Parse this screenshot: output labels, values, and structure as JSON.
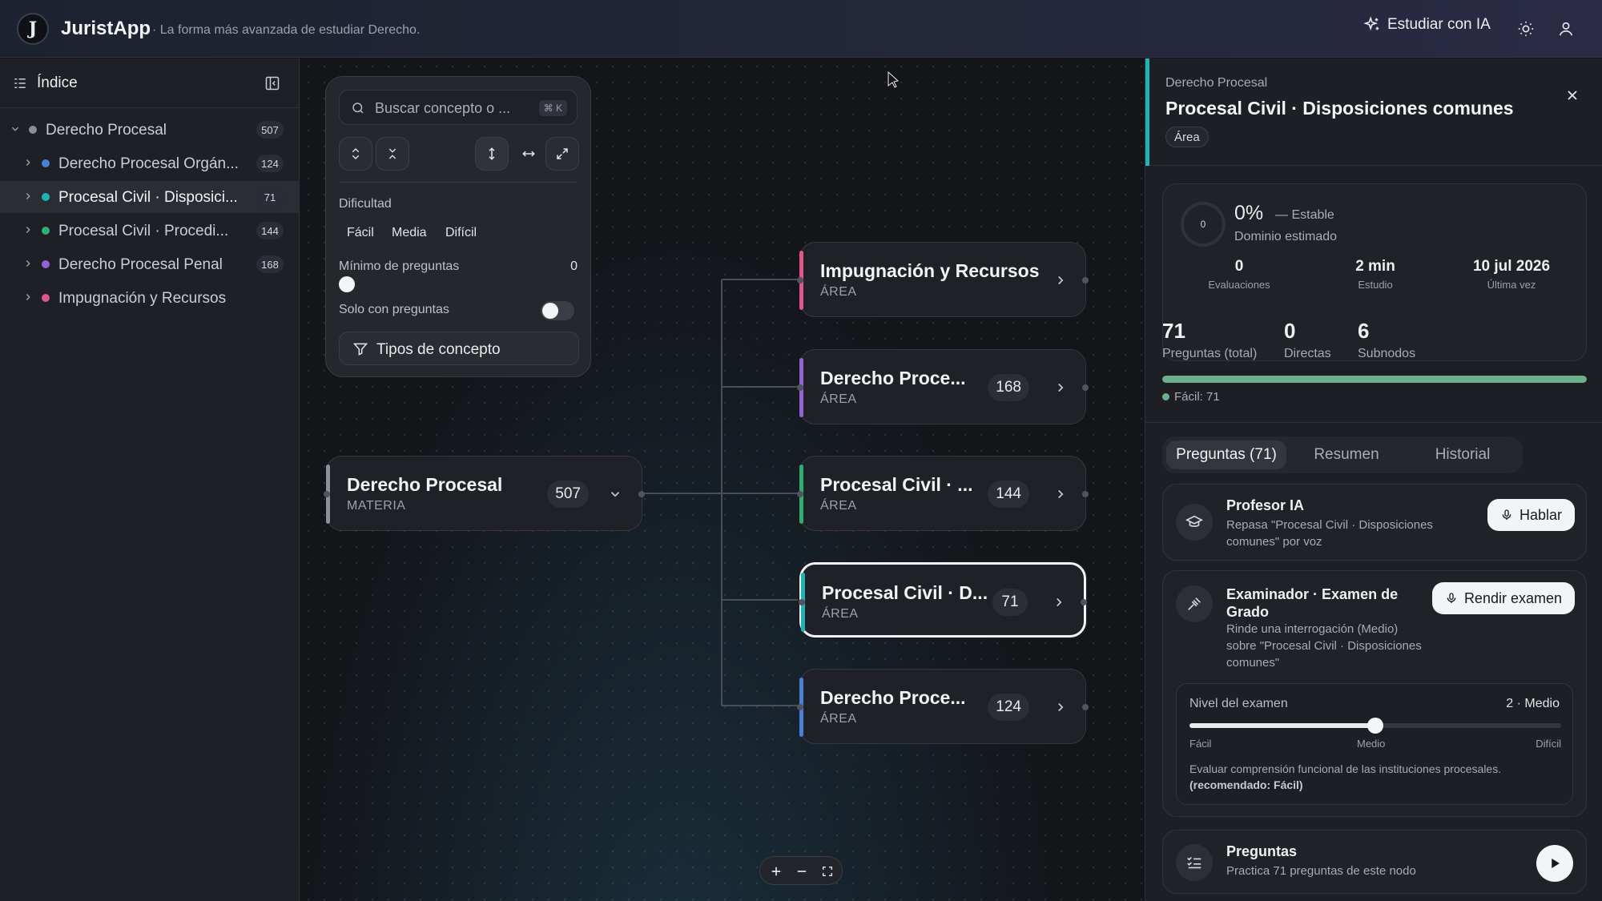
{
  "header": {
    "app_name": "JuristApp",
    "logo_letter": "J",
    "tagline": "· La forma más avanzada de estudiar Derecho.",
    "study_ai_label": "Estudiar con IA",
    "icons": [
      "sparkles-icon",
      "sun-icon",
      "user-icon"
    ]
  },
  "sidebar": {
    "title": "Índice",
    "items": [
      {
        "label": "Derecho Procesal",
        "count": "507",
        "color": "#8b8f98",
        "expanded": true,
        "level": 0
      },
      {
        "label": "Derecho Procesal Orgán...",
        "count": "124",
        "color": "#4a7fd6",
        "level": 1
      },
      {
        "label": "Procesal Civil · Disposici...",
        "count": "71",
        "color": "#1fb3b3",
        "level": 1,
        "active": true
      },
      {
        "label": "Procesal Civil · Procedi...",
        "count": "144",
        "color": "#2fae74",
        "level": 1
      },
      {
        "label": "Derecho Procesal Penal",
        "count": "168",
        "color": "#9363d6",
        "level": 1
      },
      {
        "label": "Impugnación y Recursos",
        "count": "",
        "color": "#e0568a",
        "level": 1
      }
    ]
  },
  "filters": {
    "search_placeholder": "Buscar concepto o ...",
    "shortcut": "⌘ K",
    "difficulty_label": "Dificultad",
    "difficulty_options": [
      "Fácil",
      "Media",
      "Difícil"
    ],
    "min_questions_label": "Mínimo de preguntas",
    "min_questions_value": "0",
    "only_with_questions_label": "Solo con preguntas",
    "concept_types_label": "Tipos de concepto"
  },
  "graph": {
    "root": {
      "title": "Derecho Procesal",
      "subtitle": "MATERIA",
      "count": "507"
    },
    "children": [
      {
        "title": "Impugnación y Recursos",
        "subtitle": "ÁREA",
        "count": "",
        "color": "#e0568a"
      },
      {
        "title": "Derecho Proce...",
        "subtitle": "ÁREA",
        "count": "168",
        "color": "#9363d6"
      },
      {
        "title": "Procesal Civil · ...",
        "subtitle": "ÁREA",
        "count": "144",
        "color": "#2fae74"
      },
      {
        "title": "Procesal Civil · D...",
        "subtitle": "ÁREA",
        "count": "71",
        "color": "#1fb3b3",
        "selected": true
      },
      {
        "title": "Derecho Proce...",
        "subtitle": "ÁREA",
        "count": "124",
        "color": "#4a7fd6"
      }
    ]
  },
  "panel": {
    "breadcrumb": "Derecho Procesal",
    "title": "Procesal Civil · Disposiciones comunes",
    "tag": "Área",
    "mastery": {
      "ring_value": "0",
      "percent": "0%",
      "trend": "— Estable",
      "label": "Dominio estimado",
      "stats": [
        {
          "value": "0",
          "label": "Evaluaciones"
        },
        {
          "value": "2 min",
          "label": "Estudio"
        },
        {
          "value": "10 jul 2026",
          "label": "Última vez"
        }
      ]
    },
    "questions": {
      "stats": [
        {
          "value": "71",
          "label": "Preguntas (total)"
        },
        {
          "value": "0",
          "label": "Directas"
        },
        {
          "value": "6",
          "label": "Subnodos"
        }
      ],
      "easy_fraction": 1.0,
      "easy_legend": "Fácil: 71"
    },
    "tabs": [
      "Preguntas (71)",
      "Resumen",
      "Historial"
    ],
    "ai_professor": {
      "title": "Profesor IA",
      "desc": "Repasa \"Procesal Civil · Disposiciones comunes\" por voz",
      "button": "Hablar"
    },
    "examiner": {
      "title": "Examinador · Examen de Grado",
      "desc": "Rinde una interrogación (Medio) sobre \"Procesal Civil · Disposiciones comunes\"",
      "button": "Rendir examen",
      "level_label": "Nivel del examen",
      "level_value": "2 · Medio",
      "level_fraction": 0.5,
      "ticks": [
        "Fácil",
        "Medio",
        "Difícil"
      ],
      "note": "Evaluar comprensión funcional de las instituciones procesales.",
      "recommended": "(recomendado: Fácil)"
    },
    "practice": {
      "title": "Preguntas",
      "desc": "Practica 71 preguntas de este nodo"
    }
  }
}
